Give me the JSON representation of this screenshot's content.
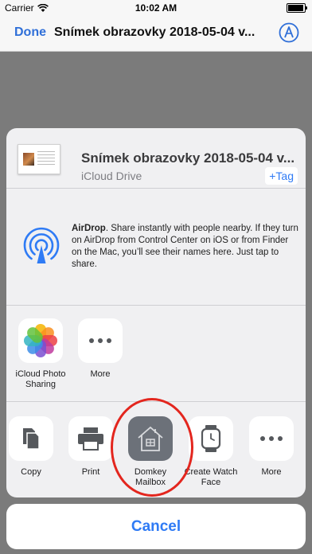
{
  "status_bar": {
    "carrier": "Carrier",
    "time": "10:02 AM"
  },
  "nav": {
    "done_label": "Done",
    "title": "Snímek obrazovky 2018-05-04 v...",
    "markup_icon": "markup-pen-icon"
  },
  "share_sheet": {
    "file": {
      "title": "Snímek obrazovky 2018-05-04 v...",
      "location": "iCloud Drive",
      "tag_label": "+Tag"
    },
    "airdrop": {
      "heading": "AirDrop",
      "description": ". Share instantly with people nearby. If they turn on AirDrop from Control Center on iOS or from Finder on the Mac, you’ll see their names here. Just tap to share."
    },
    "apps": [
      {
        "label": "iCloud Photo Sharing",
        "icon": "photos-icon"
      },
      {
        "label": "More",
        "icon": "more-dots-icon"
      }
    ],
    "actions": [
      {
        "label": "Copy",
        "icon": "copy-icon"
      },
      {
        "label": "Print",
        "icon": "printer-icon"
      },
      {
        "label": "Domkey Mailbox",
        "icon": "house-icon"
      },
      {
        "label": "Create Watch Face",
        "icon": "watch-icon"
      },
      {
        "label": "More",
        "icon": "more-dots-icon"
      }
    ],
    "cancel_label": "Cancel"
  },
  "colors": {
    "accent": "#2f7bf5",
    "highlight": "#e3261e",
    "sheet_background": "#f4f4f6"
  }
}
